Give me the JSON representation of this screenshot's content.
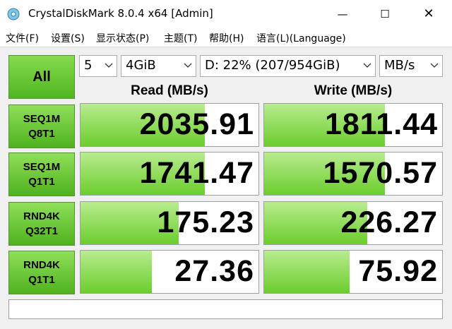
{
  "window": {
    "title": "CrystalDiskMark 8.0.4 x64 [Admin]",
    "minimize_glyph": "—",
    "maximize_glyph": "☐",
    "close_glyph": "✕"
  },
  "menu": [
    "文件(F)",
    "设置(S)",
    "显示状态(P)",
    "主题(T)",
    "帮助(H)",
    "语言(L)(Language)"
  ],
  "toolbar": {
    "all_label": "All",
    "count": "5",
    "size": "4GiB",
    "drive": "D: 22% (207/954GiB)",
    "unit": "MB/s"
  },
  "headers": {
    "read": "Read (MB/s)",
    "write": "Write (MB/s)"
  },
  "rows": [
    {
      "line1": "SEQ1M",
      "line2": "Q8T1",
      "read": "2035.91",
      "write": "1811.44",
      "read_fill": 0.7,
      "write_fill": 0.68
    },
    {
      "line1": "SEQ1M",
      "line2": "Q1T1",
      "read": "1741.47",
      "write": "1570.57",
      "read_fill": 0.7,
      "write_fill": 0.68
    },
    {
      "line1": "RND4K",
      "line2": "Q32T1",
      "read": "175.23",
      "write": "226.27",
      "read_fill": 0.55,
      "write_fill": 0.58
    },
    {
      "line1": "RND4K",
      "line2": "Q1T1",
      "read": "27.36",
      "write": "75.92",
      "read_fill": 0.4,
      "write_fill": 0.48
    }
  ],
  "status": "",
  "colors": {
    "accent_green": "#6ccd2c",
    "label_green": "#4fb21d"
  }
}
